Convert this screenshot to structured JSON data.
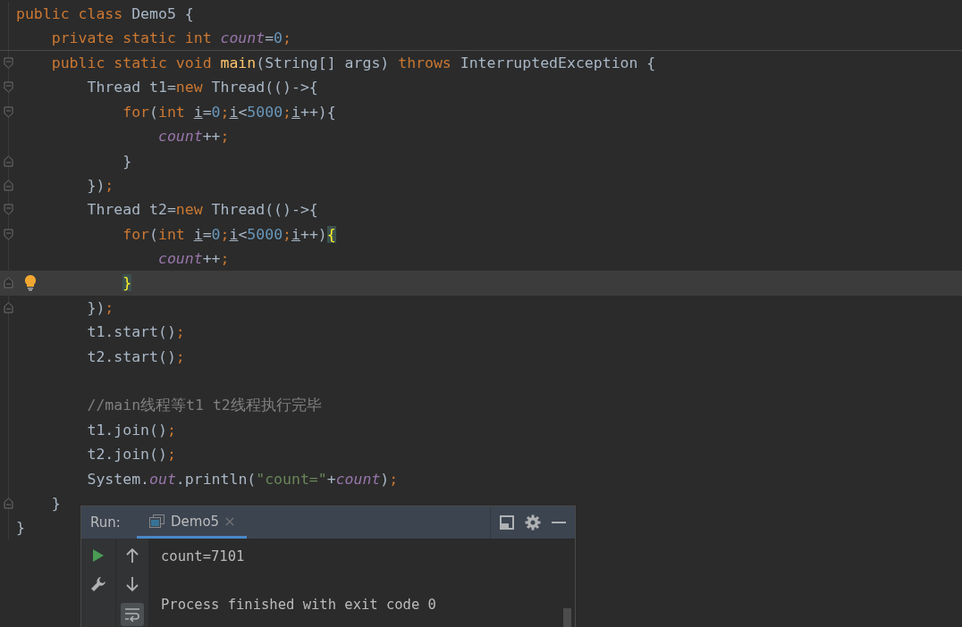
{
  "editor": {
    "lines": [
      {
        "kind": "code",
        "fold_start": false,
        "fold_end": false,
        "separator_below": false,
        "current": false,
        "bulb": false,
        "tokens": [
          {
            "kind": "kw",
            "text": "public class "
          },
          {
            "kind": "plain",
            "text": "Demo5 {"
          }
        ]
      },
      {
        "kind": "code",
        "fold_start": false,
        "fold_end": false,
        "separator_below": true,
        "current": false,
        "bulb": false,
        "tokens": [
          {
            "kind": "kw",
            "text": "    private static int "
          },
          {
            "kind": "field",
            "text": "count"
          },
          {
            "kind": "plain",
            "text": "="
          },
          {
            "kind": "num",
            "text": "0"
          },
          {
            "kind": "kw",
            "text": ";"
          }
        ]
      },
      {
        "kind": "code",
        "fold_start": true,
        "fold_end": false,
        "separator_below": false,
        "current": false,
        "bulb": false,
        "tokens": [
          {
            "kind": "kw",
            "text": "    public static void "
          },
          {
            "kind": "method",
            "text": "main"
          },
          {
            "kind": "plain",
            "text": "(String[] args) "
          },
          {
            "kind": "kw",
            "text": "throws "
          },
          {
            "kind": "plain",
            "text": "InterruptedException {"
          }
        ]
      },
      {
        "kind": "code",
        "fold_start": true,
        "fold_end": false,
        "separator_below": false,
        "current": false,
        "bulb": false,
        "tokens": [
          {
            "kind": "plain",
            "text": "        Thread t1="
          },
          {
            "kind": "kw",
            "text": "new "
          },
          {
            "kind": "plain",
            "text": "Thread(()->{"
          }
        ]
      },
      {
        "kind": "code",
        "fold_start": true,
        "fold_end": false,
        "separator_below": false,
        "current": false,
        "bulb": false,
        "tokens": [
          {
            "kind": "kw",
            "text": "            for"
          },
          {
            "kind": "plain",
            "text": "("
          },
          {
            "kind": "kw",
            "text": "int "
          },
          {
            "kind": "local",
            "text": "i"
          },
          {
            "kind": "plain",
            "text": "="
          },
          {
            "kind": "num",
            "text": "0"
          },
          {
            "kind": "kw",
            "text": ";"
          },
          {
            "kind": "local",
            "text": "i"
          },
          {
            "kind": "plain",
            "text": "<"
          },
          {
            "kind": "num",
            "text": "5000"
          },
          {
            "kind": "kw",
            "text": ";"
          },
          {
            "kind": "local",
            "text": "i"
          },
          {
            "kind": "plain",
            "text": "++){"
          }
        ]
      },
      {
        "kind": "code",
        "fold_start": false,
        "fold_end": false,
        "separator_below": false,
        "current": false,
        "bulb": false,
        "tokens": [
          {
            "kind": "field",
            "text": "                count"
          },
          {
            "kind": "plain",
            "text": "++"
          },
          {
            "kind": "kw",
            "text": ";"
          }
        ]
      },
      {
        "kind": "code",
        "fold_start": false,
        "fold_end": true,
        "separator_below": false,
        "current": false,
        "bulb": false,
        "tokens": [
          {
            "kind": "plain",
            "text": "            }"
          }
        ]
      },
      {
        "kind": "code",
        "fold_start": false,
        "fold_end": true,
        "separator_below": false,
        "current": false,
        "bulb": false,
        "tokens": [
          {
            "kind": "plain",
            "text": "        })"
          },
          {
            "kind": "kw",
            "text": ";"
          }
        ]
      },
      {
        "kind": "code",
        "fold_start": true,
        "fold_end": false,
        "separator_below": false,
        "current": false,
        "bulb": false,
        "tokens": [
          {
            "kind": "plain",
            "text": "        Thread t2="
          },
          {
            "kind": "kw",
            "text": "new "
          },
          {
            "kind": "plain",
            "text": "Thread(()->{"
          }
        ]
      },
      {
        "kind": "code",
        "fold_start": true,
        "fold_end": false,
        "separator_below": false,
        "current": false,
        "bulb": false,
        "tokens": [
          {
            "kind": "kw",
            "text": "            for"
          },
          {
            "kind": "plain",
            "text": "("
          },
          {
            "kind": "kw",
            "text": "int "
          },
          {
            "kind": "local",
            "text": "i"
          },
          {
            "kind": "plain",
            "text": "="
          },
          {
            "kind": "num",
            "text": "0"
          },
          {
            "kind": "kw",
            "text": ";"
          },
          {
            "kind": "local",
            "text": "i"
          },
          {
            "kind": "plain",
            "text": "<"
          },
          {
            "kind": "num",
            "text": "5000"
          },
          {
            "kind": "kw",
            "text": ";"
          },
          {
            "kind": "local",
            "text": "i"
          },
          {
            "kind": "plain",
            "text": "++)"
          },
          {
            "kind": "brace",
            "text": "{"
          }
        ]
      },
      {
        "kind": "code",
        "fold_start": false,
        "fold_end": false,
        "separator_below": false,
        "current": false,
        "bulb": false,
        "tokens": [
          {
            "kind": "field",
            "text": "                count"
          },
          {
            "kind": "plain",
            "text": "++"
          },
          {
            "kind": "kw",
            "text": ";"
          }
        ]
      },
      {
        "kind": "code",
        "fold_start": false,
        "fold_end": true,
        "separator_below": false,
        "current": true,
        "bulb": true,
        "tokens": [
          {
            "kind": "brace",
            "text": "            }"
          }
        ]
      },
      {
        "kind": "code",
        "fold_start": false,
        "fold_end": true,
        "separator_below": false,
        "current": false,
        "bulb": false,
        "tokens": [
          {
            "kind": "plain",
            "text": "        })"
          },
          {
            "kind": "kw",
            "text": ";"
          }
        ]
      },
      {
        "kind": "code",
        "fold_start": false,
        "fold_end": false,
        "separator_below": false,
        "current": false,
        "bulb": false,
        "tokens": [
          {
            "kind": "plain",
            "text": "        t1.start()"
          },
          {
            "kind": "kw",
            "text": ";"
          }
        ]
      },
      {
        "kind": "code",
        "fold_start": false,
        "fold_end": false,
        "separator_below": false,
        "current": false,
        "bulb": false,
        "tokens": [
          {
            "kind": "plain",
            "text": "        t2.start()"
          },
          {
            "kind": "kw",
            "text": ";"
          }
        ]
      },
      {
        "kind": "blank"
      },
      {
        "kind": "code",
        "fold_start": false,
        "fold_end": false,
        "separator_below": false,
        "current": false,
        "bulb": false,
        "tokens": [
          {
            "kind": "comment",
            "text": "        //main线程等t1 t2线程执行完毕"
          }
        ]
      },
      {
        "kind": "code",
        "fold_start": false,
        "fold_end": false,
        "separator_below": false,
        "current": false,
        "bulb": false,
        "tokens": [
          {
            "kind": "plain",
            "text": "        t1.join()"
          },
          {
            "kind": "kw",
            "text": ";"
          }
        ]
      },
      {
        "kind": "code",
        "fold_start": false,
        "fold_end": false,
        "separator_below": false,
        "current": false,
        "bulb": false,
        "tokens": [
          {
            "kind": "plain",
            "text": "        t2.join()"
          },
          {
            "kind": "kw",
            "text": ";"
          }
        ]
      },
      {
        "kind": "code",
        "fold_start": false,
        "fold_end": false,
        "separator_below": false,
        "current": false,
        "bulb": false,
        "tokens": [
          {
            "kind": "plain",
            "text": "        System."
          },
          {
            "kind": "field",
            "text": "out"
          },
          {
            "kind": "plain",
            "text": ".println("
          },
          {
            "kind": "str",
            "text": "\"count=\""
          },
          {
            "kind": "plain",
            "text": "+"
          },
          {
            "kind": "field",
            "text": "count"
          },
          {
            "kind": "plain",
            "text": ")"
          },
          {
            "kind": "kw",
            "text": ";"
          }
        ]
      },
      {
        "kind": "code",
        "fold_start": false,
        "fold_end": true,
        "separator_below": false,
        "current": false,
        "bulb": false,
        "tokens": [
          {
            "kind": "plain",
            "text": "    }"
          }
        ]
      },
      {
        "kind": "code",
        "fold_start": false,
        "fold_end": false,
        "separator_below": false,
        "current": false,
        "bulb": false,
        "tokens": [
          {
            "kind": "plain",
            "text": "}"
          }
        ]
      }
    ]
  },
  "run_panel": {
    "label": "Run:",
    "tabs": [
      {
        "label": "Demo5",
        "selected": true
      }
    ],
    "soft_wrap_on": true,
    "console": [
      {
        "kind": "output",
        "text": "count=7101"
      },
      {
        "kind": "blank"
      },
      {
        "kind": "output",
        "text": "Process finished with exit code 0"
      }
    ]
  }
}
